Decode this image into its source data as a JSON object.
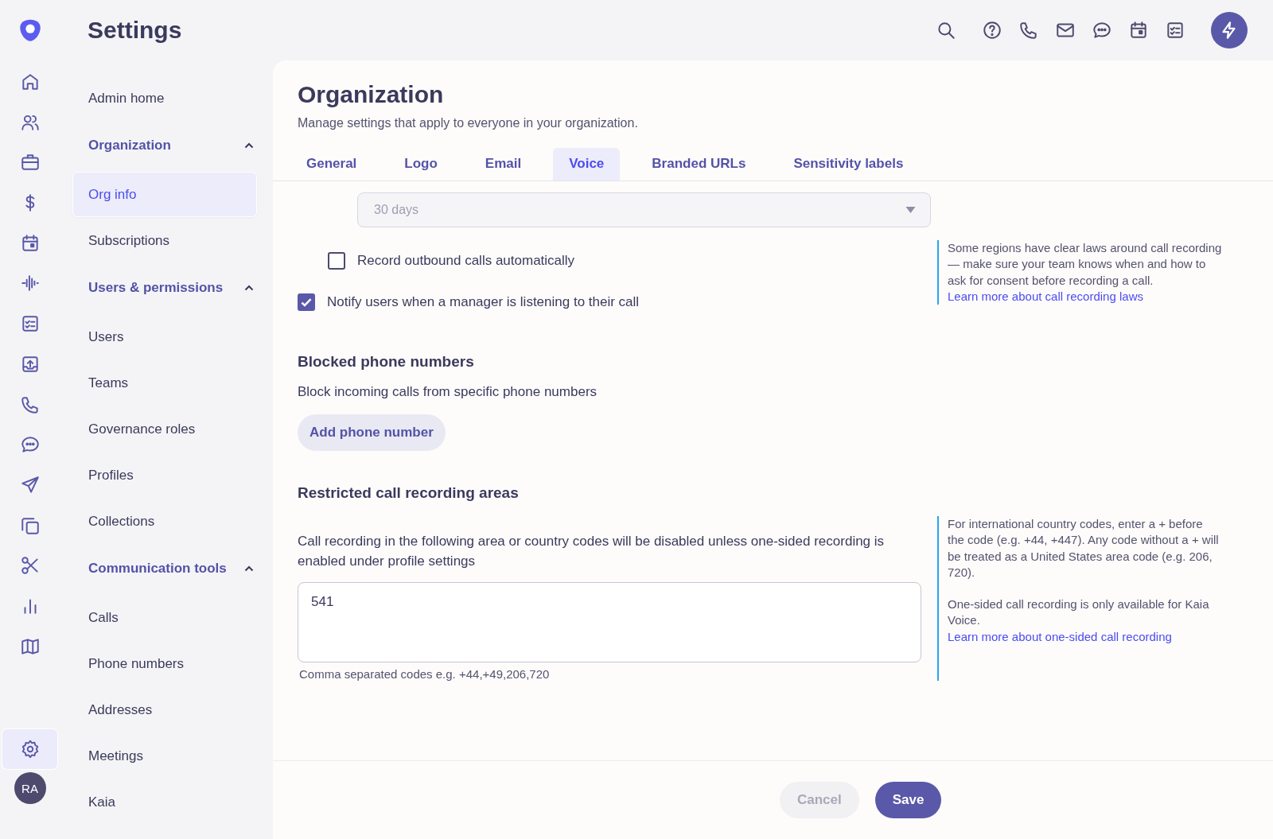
{
  "rail": {
    "items": [
      {
        "selected": false
      },
      {
        "selected": false
      },
      {
        "selected": false
      },
      {
        "selected": false
      },
      {
        "selected": false
      },
      {
        "selected": false
      },
      {
        "selected": false
      },
      {
        "selected": false
      },
      {
        "selected": false
      },
      {
        "selected": false
      },
      {
        "selected": false
      },
      {
        "selected": false
      },
      {
        "selected": false
      },
      {
        "selected": false
      },
      {
        "selected": false
      }
    ],
    "settings": {
      "selected": true
    },
    "avatar": "RA"
  },
  "sidebar": {
    "title": "Settings",
    "items": [
      {
        "kind": "link",
        "label": "Admin home",
        "selected": false
      },
      {
        "kind": "group",
        "label": "Organization",
        "expanded": true,
        "children": [
          {
            "label": "Org info",
            "selected": true
          },
          {
            "label": "Subscriptions",
            "selected": false
          }
        ]
      },
      {
        "kind": "group",
        "label": "Users & permissions",
        "expanded": true,
        "children": [
          {
            "label": "Users",
            "selected": false
          },
          {
            "label": "Teams",
            "selected": false
          },
          {
            "label": "Governance roles",
            "selected": false
          },
          {
            "label": "Profiles",
            "selected": false
          },
          {
            "label": "Collections",
            "selected": false
          }
        ]
      },
      {
        "kind": "group",
        "label": "Communication tools",
        "expanded": true,
        "children": [
          {
            "label": "Calls",
            "selected": false
          },
          {
            "label": "Phone numbers",
            "selected": false
          },
          {
            "label": "Addresses",
            "selected": false
          },
          {
            "label": "Meetings",
            "selected": false
          },
          {
            "label": "Kaia",
            "selected": false
          }
        ]
      }
    ]
  },
  "page": {
    "title": "Organization",
    "subtitle": "Manage settings that apply to everyone in your organization.",
    "tabs": [
      {
        "label": "General",
        "selected": false
      },
      {
        "label": "Logo",
        "selected": false
      },
      {
        "label": "Email",
        "selected": false
      },
      {
        "label": "Voice",
        "selected": true
      },
      {
        "label": "Branded URLs",
        "selected": false
      },
      {
        "label": "Sensitivity labels",
        "selected": false
      }
    ],
    "retention_select": {
      "value": "30 days",
      "disabled": true
    },
    "checkboxes": [
      {
        "label": "Record outbound calls automatically",
        "checked": false,
        "indented": true
      },
      {
        "label": "Notify users when a manager is listening to their call",
        "checked": true,
        "indented": false
      }
    ],
    "recording_note": {
      "paragraphs": [
        "Some regions have clear laws around call recording — make sure your team knows when and how to ask for consent before recording a call."
      ],
      "link": "Learn more about call recording laws"
    },
    "blocked": {
      "heading": "Blocked phone numbers",
      "description": "Block incoming calls from specific phone numbers",
      "button": "Add phone number"
    },
    "restricted": {
      "heading": "Restricted call recording areas",
      "description": "Call recording in the following area or country codes will be disabled unless one-sided recording is enabled under profile settings",
      "value": "541",
      "hint": "Comma separated codes e.g. +44,+49,206,720",
      "note": {
        "paragraphs": [
          "For international country codes, enter a + before the code (e.g. +44, +447). Any code without a + will be treated as a United States area code (e.g. 206, 720).",
          "One-sided call recording is only available for Kaia Voice."
        ],
        "link": "Learn more about one-sided call recording"
      }
    },
    "footer": {
      "cancel": "Cancel",
      "save": "Save"
    }
  }
}
